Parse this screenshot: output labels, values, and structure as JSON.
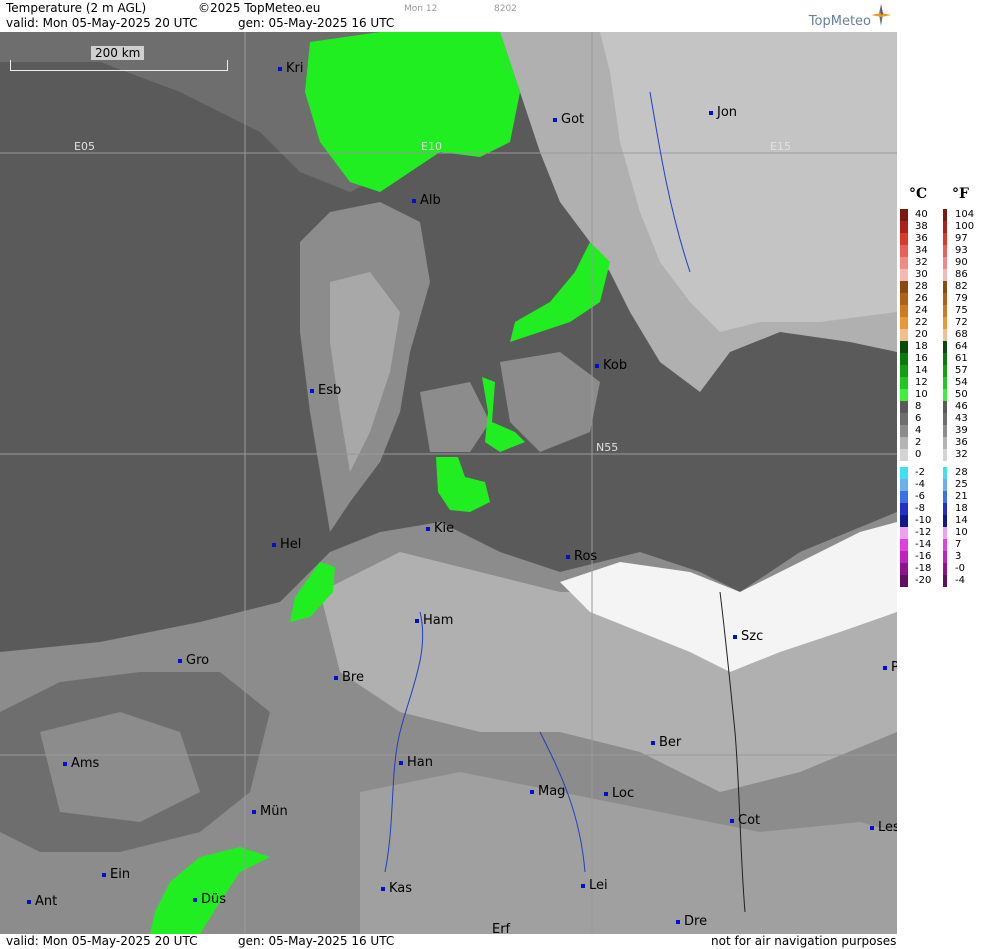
{
  "header": {
    "title": "Temperature (2 m AGL)",
    "copyright": "©2025 TopMeteo.eu",
    "run_label": "Mon 12",
    "code": "8202",
    "valid": "valid:  Mon  05-May-2025  20 UTC",
    "gen": "gen: 05-May-2025 16 UTC",
    "brand": "TopMeteo"
  },
  "footer": {
    "valid": "valid:  Mon  05-May-2025  20 UTC",
    "gen": "gen: 05-May-2025 16 UTC",
    "notice": "not for air navigation purposes"
  },
  "map": {
    "scale_label": "200 km",
    "grid_labels": [
      "E05",
      "E10",
      "E15",
      "N55"
    ],
    "cities": [
      "Kri",
      "Got",
      "Jon",
      "Alb",
      "Esb",
      "Kob",
      "Kie",
      "Ros",
      "Hel",
      "Ham",
      "Szc",
      "Gro",
      "Bre",
      "P",
      "Ams",
      "Han",
      "Ber",
      "Mün",
      "Mag",
      "Loc",
      "Cot",
      "Les",
      "Ein",
      "Ant",
      "Düs",
      "Kas",
      "Lei",
      "Dre",
      "Erf"
    ]
  },
  "legend": {
    "celsius_header": "°C",
    "fahrenheit_header": "°F",
    "celsius": [
      "40",
      "38",
      "36",
      "34",
      "32",
      "30",
      "28",
      "26",
      "24",
      "22",
      "20",
      "18",
      "16",
      "14",
      "12",
      "10",
      "8",
      "6",
      "4",
      "2",
      "0",
      "-2",
      "-4",
      "-6",
      "-8",
      "-10",
      "-12",
      "-14",
      "-16",
      "-18",
      "-20"
    ],
    "fahrenheit": [
      "104",
      "100",
      "97",
      "93",
      "90",
      "86",
      "82",
      "79",
      "75",
      "72",
      "68",
      "64",
      "61",
      "57",
      "54",
      "50",
      "46",
      "43",
      "39",
      "36",
      "32",
      "28",
      "25",
      "21",
      "18",
      "14",
      "10",
      "7",
      "3",
      "-0",
      "-4"
    ],
    "colors": [
      "#7a1a0c",
      "#b0201a",
      "#d83a2a",
      "#e86058",
      "#f08a86",
      "#f6b8b2",
      "#8a4a10",
      "#b06018",
      "#d07a20",
      "#e89838",
      "#f0c090",
      "#0a4a0a",
      "#0a7a0a",
      "#10a010",
      "#20c820",
      "#3cf03c",
      "#5a5a5a",
      "#6e6e6e",
      "#8c8c8c",
      "#b4b4b4",
      "#d4d4d4",
      "#40e0f0",
      "#6ab0f0",
      "#3a70e8",
      "#2030c8",
      "#101890",
      "#f0a0f0",
      "#e040e0",
      "#c020c0",
      "#901090",
      "#601060"
    ]
  }
}
